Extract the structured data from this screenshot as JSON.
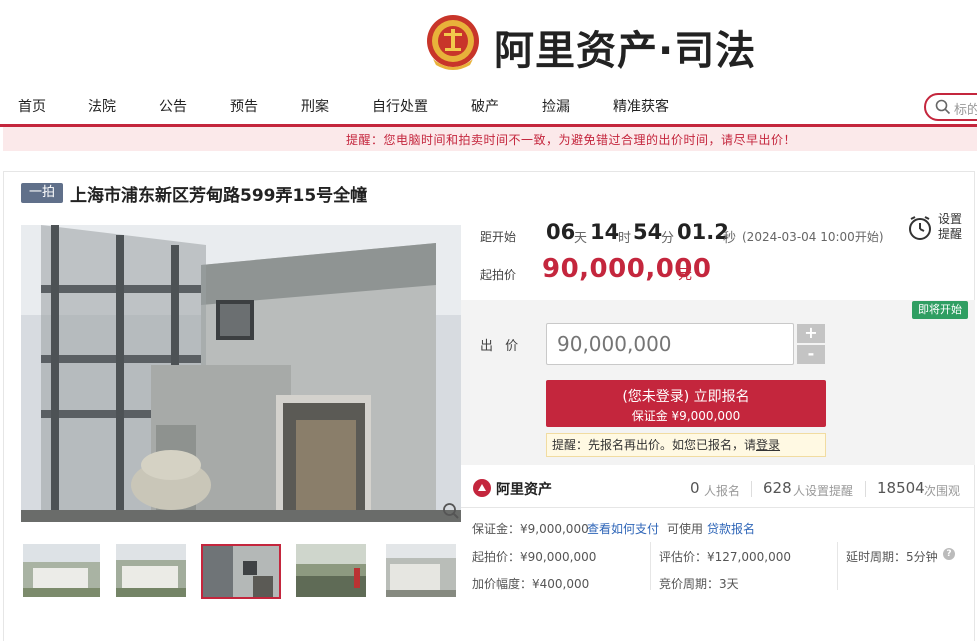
{
  "header": {
    "brand": "阿里资产·司法"
  },
  "nav": {
    "items": [
      "首页",
      "法院",
      "公告",
      "预告",
      "刑案",
      "自行处置",
      "破产",
      "捡漏",
      "精准获客"
    ],
    "search_placeholder": "标的"
  },
  "notice": "提醒：您电脑时间和拍卖时间不一致，为避免错过合理的出价时间，请尽早出价！",
  "lot": {
    "badge": "一拍",
    "title": "上海市浦东新区芳甸路599弄15号全幢"
  },
  "countdown": {
    "label": "距开始",
    "days": "06",
    "days_unit": "天",
    "hours": "14",
    "hours_unit": "时",
    "minutes": "54",
    "minutes_unit": "分",
    "seconds": "01.2",
    "seconds_unit": "秒",
    "note": "(2024-03-04 10:00开始)"
  },
  "remind": {
    "label": "设置提醒"
  },
  "price": {
    "label": "起拍价",
    "value": "90,000,000",
    "unit": "元"
  },
  "bid": {
    "status_badge": "即将开始",
    "label": "出 价",
    "input_placeholder": "90,000,000",
    "plus": "+",
    "minus": "-",
    "register_main": "(您未登录) 立即报名",
    "register_sub": "保证金 ¥9,000,000",
    "tip_prefix": "提醒：先报名再出价。如您已报名，请",
    "tip_link": "登录"
  },
  "stats": {
    "brand": "阿里资产",
    "signups": "0",
    "signups_label": "人报名",
    "reminders": "628",
    "reminders_label": "人设置提醒",
    "views": "18504",
    "views_label": "次围观"
  },
  "info": {
    "deposit": "保证金：¥9,000,000",
    "how_to_pay": "查看如何支付",
    "can_use": "可使用",
    "loan_signup": "贷款报名",
    "start_price": "起拍价：¥90,000,000",
    "increment": "加价幅度：¥400,000",
    "appraisal": "评估价：¥127,000,000",
    "bid_cycle": "竞价周期：3天",
    "delay_cycle": "延时周期：5分钟",
    "help": "?"
  },
  "colors": {
    "accent": "#c4263d",
    "badge_gray": "#60708a",
    "status_green": "#2f9e62",
    "link_blue": "#2f66b8"
  }
}
